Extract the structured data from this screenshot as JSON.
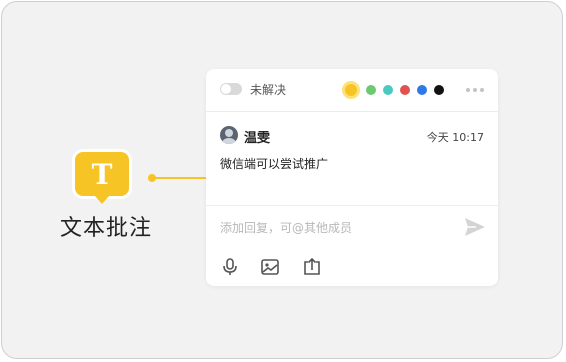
{
  "annotation": {
    "icon_letter": "T",
    "label": "文本批注",
    "accent": "#f7c425"
  },
  "card": {
    "toggle_label": "未解决",
    "colors": [
      "#f7c425",
      "#6cc96f",
      "#49c9c0",
      "#e0534f",
      "#2f78e8",
      "#111111"
    ],
    "selected_color_index": 0,
    "comment": {
      "author": "温雯",
      "time": "今天 10:17",
      "text": "微信端可以尝试推广"
    },
    "reply_placeholder": "添加回复，可@其他成员",
    "tools": [
      "microphone-icon",
      "image-icon",
      "upload-icon"
    ],
    "send_icon": "send-icon"
  }
}
